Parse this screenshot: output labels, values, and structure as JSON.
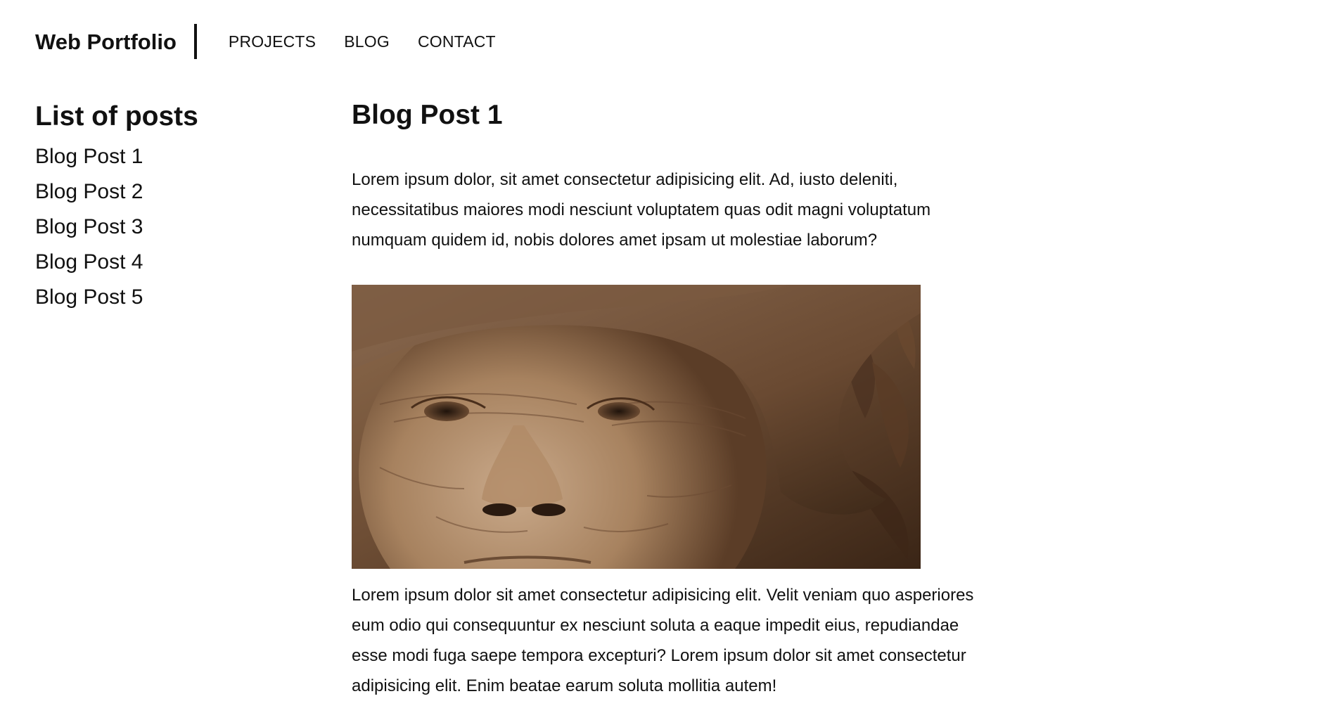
{
  "header": {
    "brand": "Web Portfolio",
    "nav": [
      {
        "label": "PROJECTS"
      },
      {
        "label": "BLOG"
      },
      {
        "label": "CONTACT"
      }
    ]
  },
  "sidebar": {
    "title": "List of posts",
    "posts": [
      {
        "label": "Blog Post 1"
      },
      {
        "label": "Blog Post 2"
      },
      {
        "label": "Blog Post 3"
      },
      {
        "label": "Blog Post 4"
      },
      {
        "label": "Blog Post 5"
      }
    ]
  },
  "main": {
    "title": "Blog Post 1",
    "paragraph1": "Lorem ipsum dolor, sit amet consectetur adipisicing elit. Ad, iusto deleniti, necessitatibus maiores modi nesciunt voluptatem quas odit magni voluptatum numquam quidem id, nobis dolores amet ipsam ut molestiae laborum?",
    "paragraph2": "Lorem ipsum dolor sit amet consectetur adipisicing elit. Velit veniam quo asperiores eum odio qui consequuntur ex nesciunt soluta a eaque impedit eius, repudiandae esse modi fuga saepe tempora excepturi? Lorem ipsum dolor sit amet consectetur adipisicing elit. Enim beatae earum soluta mollitia autem!"
  }
}
